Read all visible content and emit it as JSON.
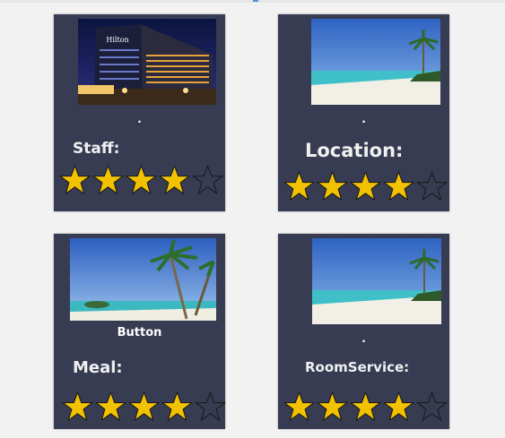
{
  "cards": [
    {
      "caption": ".",
      "label": "Staff:",
      "rating": 4,
      "max": 5,
      "image": "hilton-hotel-photo"
    },
    {
      "caption": ".",
      "label": "Location:",
      "rating": 4,
      "max": 5,
      "image": "beach-photo"
    },
    {
      "caption": "Button",
      "label": "Meal:",
      "rating": 4,
      "max": 5,
      "image": "palm-beach-photo"
    },
    {
      "caption": ".",
      "label": "RoomService:",
      "rating": 4,
      "max": 5,
      "image": "beach-photo"
    }
  ],
  "hotel_sign": "Hilton",
  "colors": {
    "card": "#373c52",
    "star_fill": "#f2c200",
    "star_outline": "#1a1a1a",
    "page": "#f2f2f2"
  },
  "icons": {
    "filled": "star-filled-icon",
    "empty": "star-empty-icon"
  }
}
